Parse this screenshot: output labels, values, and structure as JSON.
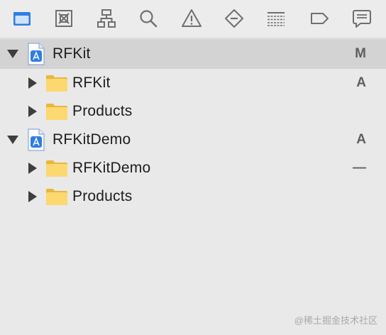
{
  "toolbar": {
    "buttons": [
      {
        "icon": "folder-icon",
        "active": true
      },
      {
        "icon": "source-control-icon",
        "active": false
      },
      {
        "icon": "hierarchy-icon",
        "active": false
      },
      {
        "icon": "search-icon",
        "active": false
      },
      {
        "icon": "warning-icon",
        "active": false
      },
      {
        "icon": "test-diamond-icon",
        "active": false
      },
      {
        "icon": "debug-list-icon",
        "active": false
      },
      {
        "icon": "breakpoint-tag-icon",
        "active": false
      },
      {
        "icon": "report-message-icon",
        "active": false
      }
    ],
    "accent_color": "#2f7de1"
  },
  "tree": {
    "items": [
      {
        "label": "RFKit",
        "status": "M",
        "kind": "project",
        "level": 0,
        "expanded": true,
        "selected": true
      },
      {
        "label": "RFKit",
        "status": "A",
        "kind": "folder",
        "level": 1,
        "expanded": false
      },
      {
        "label": "Products",
        "status": "",
        "kind": "folder",
        "level": 1,
        "expanded": false
      },
      {
        "label": "RFKitDemo",
        "status": "A",
        "kind": "project",
        "level": 0,
        "expanded": true
      },
      {
        "label": "RFKitDemo",
        "status": "—",
        "kind": "folder",
        "level": 1,
        "expanded": false
      },
      {
        "label": "Products",
        "status": "",
        "kind": "folder",
        "level": 1,
        "expanded": false
      }
    ]
  },
  "watermark": "@稀土掘金技术社区"
}
